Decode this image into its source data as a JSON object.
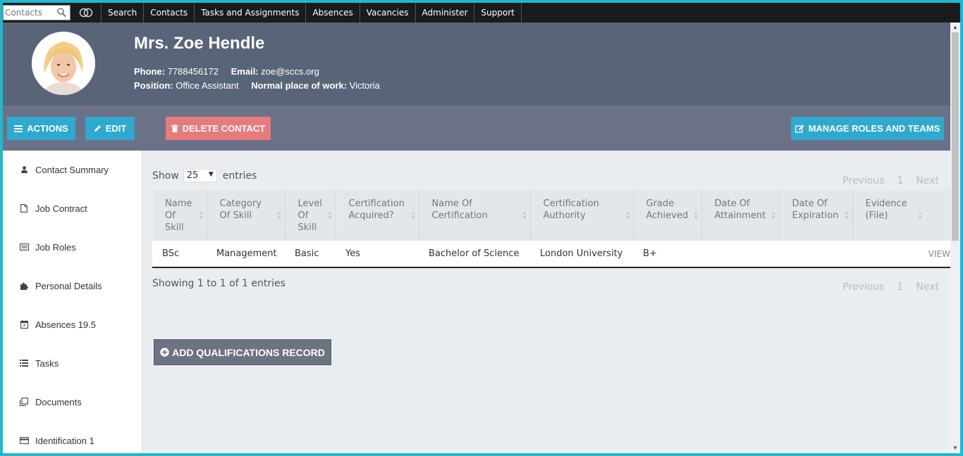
{
  "topnav": {
    "search_placeholder": "Contacts",
    "items": [
      "Search",
      "Contacts",
      "Tasks and Assignments",
      "Absences",
      "Vacancies",
      "Administer",
      "Support"
    ]
  },
  "contact": {
    "name": "Mrs. Zoe Hendle",
    "phone_label": "Phone:",
    "phone": "7788456172",
    "email_label": "Email:",
    "email": "zoe@sccs.org",
    "position_label": "Position:",
    "position": "Office Assistant",
    "workplace_label": "Normal place of work:",
    "workplace": "Victoria"
  },
  "actions": {
    "actions_label": "ACTIONS",
    "edit_label": "EDIT",
    "delete_label": "DELETE CONTACT",
    "manage_label": "MANAGE ROLES AND TEAMS"
  },
  "sidebar": {
    "items": [
      {
        "label": "Contact Summary",
        "icon": "user-icon"
      },
      {
        "label": "Job Contract",
        "icon": "file-icon"
      },
      {
        "label": "Job Roles",
        "icon": "list-box-icon"
      },
      {
        "label": "Personal Details",
        "icon": "puzzle-icon"
      },
      {
        "label": "Absences 19.5",
        "icon": "calendar-icon"
      },
      {
        "label": "Tasks",
        "icon": "list-icon"
      },
      {
        "label": "Documents",
        "icon": "documents-icon"
      },
      {
        "label": "Identification 1",
        "icon": "card-icon"
      }
    ]
  },
  "table": {
    "show_label": "Show",
    "entries_label": "entries",
    "page_length": "25",
    "pager": {
      "previous": "Previous",
      "page": "1",
      "next": "Next"
    },
    "columns": [
      [
        "Name",
        "Of",
        "Skill"
      ],
      [
        "Category",
        "Of Skill"
      ],
      [
        "Level",
        "Of",
        "Skill"
      ],
      [
        "Certification",
        "Acquired?"
      ],
      [
        "Name Of",
        "Certification"
      ],
      [
        "Certification",
        "Authority"
      ],
      [
        "Grade",
        "Achieved"
      ],
      [
        "Date Of",
        "Attainment"
      ],
      [
        "Date Of",
        "Expiration"
      ],
      [
        "Evidence",
        "(File)"
      ]
    ],
    "rows": [
      [
        "BSc",
        "Management",
        "Basic",
        "Yes",
        "Bachelor of Science",
        "London University",
        "B+",
        "",
        "",
        ""
      ]
    ],
    "view_label": "VIEW",
    "showing": "Showing 1 to 1 of 1 entries"
  },
  "add_button_label": "ADD QUALIFICATIONS RECORD",
  "colors": {
    "accent": "#2fa9cd",
    "danger": "#e77b7b",
    "header_bg": "#5a6478",
    "action_bar_bg": "#6b7288",
    "frame": "#1fb8cf"
  }
}
